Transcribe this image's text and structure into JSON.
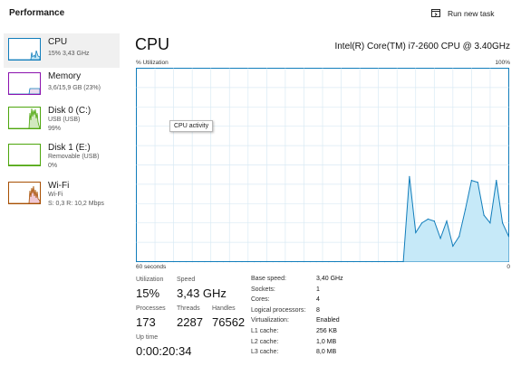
{
  "header": {
    "title": "Performance",
    "run_new_task": "Run new task"
  },
  "sidebar": {
    "items": [
      {
        "name": "CPU",
        "sub1": "15% 3,43 GHz",
        "sub2": "",
        "sub3": "",
        "color": "#117dbb"
      },
      {
        "name": "Memory",
        "sub1": "3,6/15,9 GB (23%)",
        "sub2": "",
        "sub3": "",
        "color": "#8b12ae"
      },
      {
        "name": "Disk 0 (C:)",
        "sub1": "USB (USB)",
        "sub2": "99%",
        "sub3": "",
        "color": "#4da60c"
      },
      {
        "name": "Disk 1 (E:)",
        "sub1": "Removable (USB)",
        "sub2": "0%",
        "sub3": "",
        "color": "#4da60c"
      },
      {
        "name": "Wi-Fi",
        "sub1": "Wi-Fi",
        "sub2": "S: 0,3  R: 10,2 Mbps",
        "sub3": "",
        "color": "#a74f01"
      }
    ]
  },
  "main": {
    "title": "CPU",
    "model": "Intel(R) Core(TM) i7-2600 CPU @ 3.40GHz",
    "y_axis_label": "% Utilization",
    "y_axis_max": "100%",
    "x_axis_left": "60 seconds",
    "x_axis_right": "0",
    "tooltip": "CPU activity",
    "accent": "#117dbb",
    "fill": "#c6e9f8",
    "stats": {
      "utilization_label": "Utilization",
      "utilization": "15%",
      "speed_label": "Speed",
      "speed": "3,43 GHz",
      "processes_label": "Processes",
      "processes": "173",
      "threads_label": "Threads",
      "threads": "2287",
      "handles_label": "Handles",
      "handles": "76562",
      "uptime_label": "Up time",
      "uptime": "0:00:20:34"
    },
    "info": [
      {
        "label": "Base speed:",
        "value": "3,40 GHz"
      },
      {
        "label": "Sockets:",
        "value": "1"
      },
      {
        "label": "Cores:",
        "value": "4"
      },
      {
        "label": "Logical processors:",
        "value": "8"
      },
      {
        "label": "Virtualization:",
        "value": "Enabled"
      },
      {
        "label": "L1 cache:",
        "value": "256 KB"
      },
      {
        "label": "L2 cache:",
        "value": "1,0 MB"
      },
      {
        "label": "L3 cache:",
        "value": "8,0 MB"
      }
    ]
  },
  "chart_data": {
    "type": "area",
    "x_seconds_ago": [
      60,
      59,
      58,
      57,
      56,
      55,
      54,
      53,
      52,
      51,
      50,
      49,
      48,
      47,
      46,
      45,
      44,
      43,
      42,
      41,
      40,
      39,
      38,
      37,
      36,
      35,
      34,
      33,
      32,
      31,
      30,
      29,
      28,
      27,
      26,
      25,
      24,
      23,
      22,
      21,
      20,
      19,
      18,
      17,
      16,
      15,
      14,
      13,
      12,
      11,
      10,
      9,
      8,
      7,
      6,
      5,
      4,
      3,
      2,
      1,
      0
    ],
    "y_percent": [
      0,
      0,
      0,
      0,
      0,
      0,
      0,
      0,
      0,
      0,
      0,
      0,
      0,
      0,
      0,
      0,
      0,
      0,
      0,
      0,
      0,
      0,
      0,
      0,
      0,
      0,
      0,
      0,
      0,
      0,
      0,
      0,
      0,
      0,
      0,
      0,
      0,
      0,
      0,
      0,
      0,
      0,
      0,
      0,
      44,
      15,
      20,
      22,
      21,
      12,
      21,
      8,
      13,
      27,
      42,
      41,
      24,
      20,
      42,
      20,
      13
    ],
    "ylim": [
      0,
      100
    ],
    "ylabel": "% Utilization",
    "xlabel_left": "60 seconds",
    "xlabel_right": "0",
    "grid": true
  }
}
